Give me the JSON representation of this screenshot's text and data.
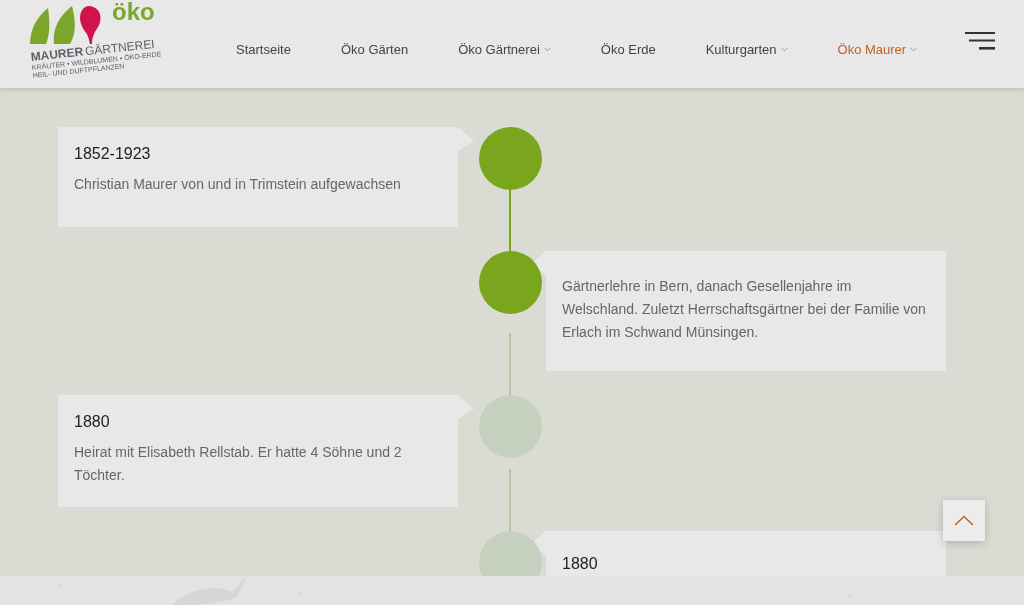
{
  "logo": {
    "word": "öko",
    "name": "MAURER",
    "trade": "GÄRTNEREI",
    "tagline_1": "KRÄUTER • WILDBLUMEN • ÖKO-ERDE",
    "tagline_2": "HEIL- UND DUFTPFLANZEN"
  },
  "nav": [
    {
      "label": "Startseite",
      "selected": false,
      "dropdown": false
    },
    {
      "label": "Öko Gärten",
      "selected": false,
      "dropdown": false
    },
    {
      "label": "Öko Gärtnerei",
      "selected": false,
      "dropdown": true
    },
    {
      "label": "Öko Erde",
      "selected": false,
      "dropdown": false
    },
    {
      "label": "Kulturgarten",
      "selected": false,
      "dropdown": true
    },
    {
      "label": "Öko Maurer",
      "selected": true,
      "dropdown": true
    }
  ],
  "timeline": [
    {
      "kind": "left",
      "active": true,
      "year": "1852-1923",
      "text": "Christian Maurer von und in Trimstein aufgewachsen"
    },
    {
      "kind": "right",
      "active": true,
      "text": "Gärtnerlehre in Bern, danach Gesellenjahre im Welschland. Zuletzt Herrschaftsgärtner bei der Familie von Erlach im Schwand Münsingen."
    },
    {
      "kind": "left",
      "active": false,
      "year": "1880",
      "text": "Heirat mit Elisabeth Rellstab. Er hatte 4 Söhne und 2 Töchter."
    },
    {
      "kind": "right",
      "active": false,
      "year": "1880"
    }
  ]
}
